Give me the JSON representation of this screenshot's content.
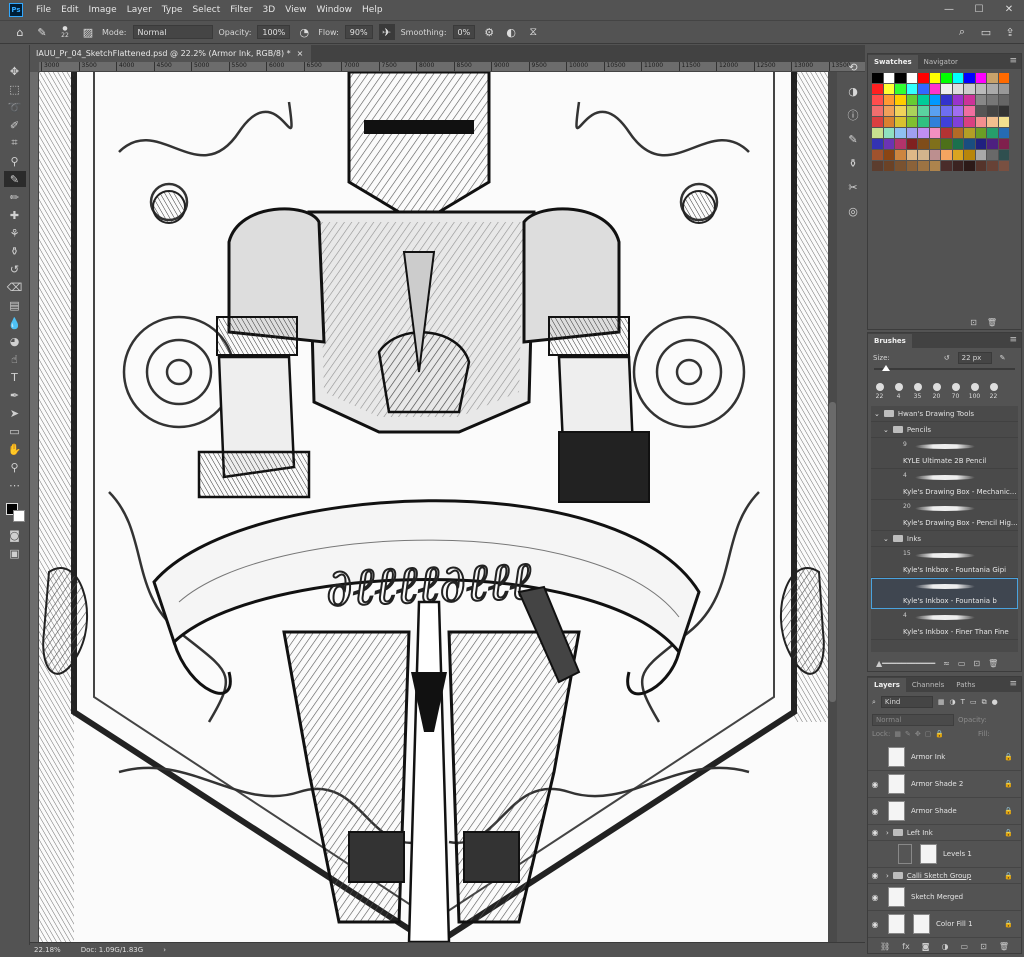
{
  "app": {
    "logo": "Ps"
  },
  "menu": [
    "File",
    "Edit",
    "Image",
    "Layer",
    "Type",
    "Select",
    "Filter",
    "3D",
    "View",
    "Window",
    "Help"
  ],
  "options": {
    "brush_size": "22",
    "mode_label": "Mode:",
    "mode_value": "Normal",
    "opacity_label": "Opacity:",
    "opacity_value": "100%",
    "flow_label": "Flow:",
    "flow_value": "90%",
    "smoothing_label": "Smoothing:",
    "smoothing_value": "0%"
  },
  "document": {
    "tab_title": "IAUU_Pr_04_SketchFlattened.psd @ 22.2% (Armor Ink, RGB/8) *",
    "zoom": "22.18%",
    "doc_size": "Doc: 1.09G/1.83G"
  },
  "ruler_ticks": [
    "3000",
    "3500",
    "4000",
    "4500",
    "5000",
    "5500",
    "6000",
    "6500",
    "7000",
    "7500",
    "8000",
    "8500",
    "9000",
    "9500",
    "10000",
    "10500",
    "11000",
    "11500",
    "12000",
    "12500",
    "13000",
    "13500"
  ],
  "swatches_panel": {
    "tabs": [
      "Swatches",
      "Navigator"
    ],
    "colors": [
      "#000000",
      "#ffffff",
      "#000000",
      "#ffffff",
      "#ff0000",
      "#ffff00",
      "#00ff00",
      "#00ffff",
      "#0000ff",
      "#ff00ff",
      "#c8a26a",
      "#ff6a00",
      "#ff2020",
      "#ffff33",
      "#33ff33",
      "#33ffff",
      "#3366ff",
      "#ff33cc",
      "#eeeeee",
      "#dddddd",
      "#cccccc",
      "#bbbbbb",
      "#aaaaaa",
      "#999999",
      "#ff4d4d",
      "#ff9933",
      "#ffcc00",
      "#66cc33",
      "#00cc99",
      "#0099ff",
      "#3333cc",
      "#9933cc",
      "#cc3399",
      "#888888",
      "#777777",
      "#666666",
      "#f06e6e",
      "#f0a05a",
      "#f0d25a",
      "#aad25a",
      "#5ad2a0",
      "#5aa0f0",
      "#6e6ef0",
      "#a06ef0",
      "#f06ea0",
      "#555555",
      "#444444",
      "#333333",
      "#d94040",
      "#d98030",
      "#d9c030",
      "#80c030",
      "#30c080",
      "#3080d9",
      "#4040d9",
      "#8040d9",
      "#d94080",
      "#f28f8f",
      "#f2bf8f",
      "#f2e08f",
      "#c8e08f",
      "#8fe0c0",
      "#8fc0f2",
      "#a0a0f2",
      "#c08ff2",
      "#f28fc0",
      "#b33333",
      "#b36b26",
      "#b39e26",
      "#6b9e26",
      "#269e6b",
      "#266bb3",
      "#3333b3",
      "#6b33b3",
      "#b3336b",
      "#802020",
      "#804d1a",
      "#80701a",
      "#4d701a",
      "#1a704d",
      "#1a4d80",
      "#202080",
      "#4d2080",
      "#80204d",
      "#a0522d",
      "#8b4513",
      "#cd853f",
      "#deb887",
      "#d2b48c",
      "#bc8f8f",
      "#f4a460",
      "#daa520",
      "#b8860b",
      "#a9a9a9",
      "#696969",
      "#2f4f4f",
      "#5c3d2e",
      "#6b4226",
      "#7a5230",
      "#8b6239",
      "#9c7343",
      "#ad844d",
      "#4a2c2a",
      "#3b2321",
      "#2c1a18",
      "#55342b",
      "#674236",
      "#795041"
    ]
  },
  "brushes_panel": {
    "title": "Brushes",
    "size_label": "Size:",
    "size_value": "22 px",
    "presets": [
      "22",
      "4",
      "35",
      "20",
      "70",
      "100",
      "22"
    ],
    "group_root": "Hwan's Drawing Tools",
    "folders": [
      {
        "name": "Pencils",
        "items": [
          {
            "num": "9",
            "name": "KYLE Ultimate 2B Pencil"
          },
          {
            "num": "4",
            "name": "Kyle's Drawing Box - Mechanic..."
          },
          {
            "num": "20",
            "name": "Kyle's Drawing Box - Pencil Hig..."
          }
        ]
      },
      {
        "name": "Inks",
        "items": [
          {
            "num": "15",
            "name": "Kyle's Inkbox - Fountania Gipi"
          },
          {
            "num": "",
            "name": "Kyle's Inkbox - Fountania b"
          },
          {
            "num": "4",
            "name": "Kyle's Inkbox - Finer Than Fine"
          }
        ]
      }
    ]
  },
  "layers_panel": {
    "tabs": [
      "Layers",
      "Channels",
      "Paths"
    ],
    "kind": "Kind",
    "blend": "Normal",
    "opacity_label": "Opacity:",
    "lock_label": "Lock:",
    "fill_label": "Fill:",
    "layers": [
      {
        "name": "Armor Ink",
        "visible": false,
        "locked": true,
        "type": "layer"
      },
      {
        "name": "Armor Shade 2",
        "visible": true,
        "locked": true,
        "type": "layer"
      },
      {
        "name": "Armor Shade",
        "visible": true,
        "locked": true,
        "type": "layer"
      },
      {
        "name": "Left Ink",
        "visible": true,
        "locked": true,
        "type": "group"
      },
      {
        "name": "Levels 1",
        "visible": false,
        "locked": false,
        "type": "adjust"
      },
      {
        "name": "Calli Sketch Group",
        "visible": true,
        "locked": true,
        "type": "group"
      },
      {
        "name": "Sketch Merged",
        "visible": true,
        "locked": false,
        "type": "layer"
      },
      {
        "name": "Color Fill 1",
        "visible": true,
        "locked": true,
        "type": "fill"
      }
    ]
  }
}
